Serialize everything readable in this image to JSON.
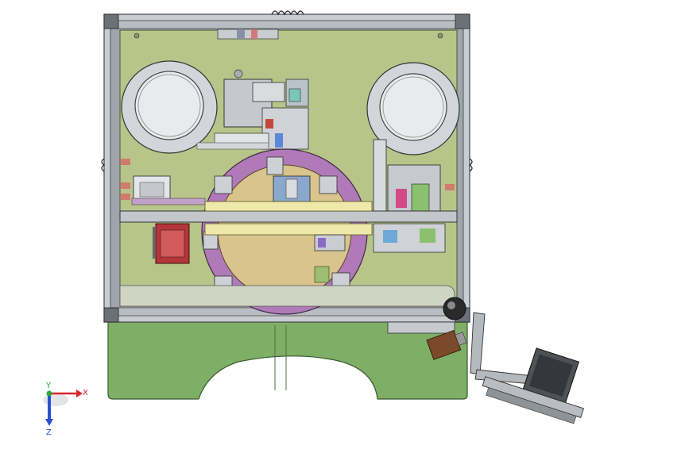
{
  "triad": {
    "x_label": "X",
    "y_label": "Y",
    "z_label": "Z"
  },
  "colors": {
    "background": "#ffffff",
    "base_green": "#7fae66",
    "plate_olive": "#b8c48a",
    "frame_gray": "#a9afb6",
    "turntable_purple": "#b07ab8",
    "turntable_inner": "#d8c48c",
    "rail_yellow": "#eee9a8",
    "axis_x": "#d8262b",
    "axis_y": "#2ca83a",
    "axis_z": "#2a4fd6"
  }
}
